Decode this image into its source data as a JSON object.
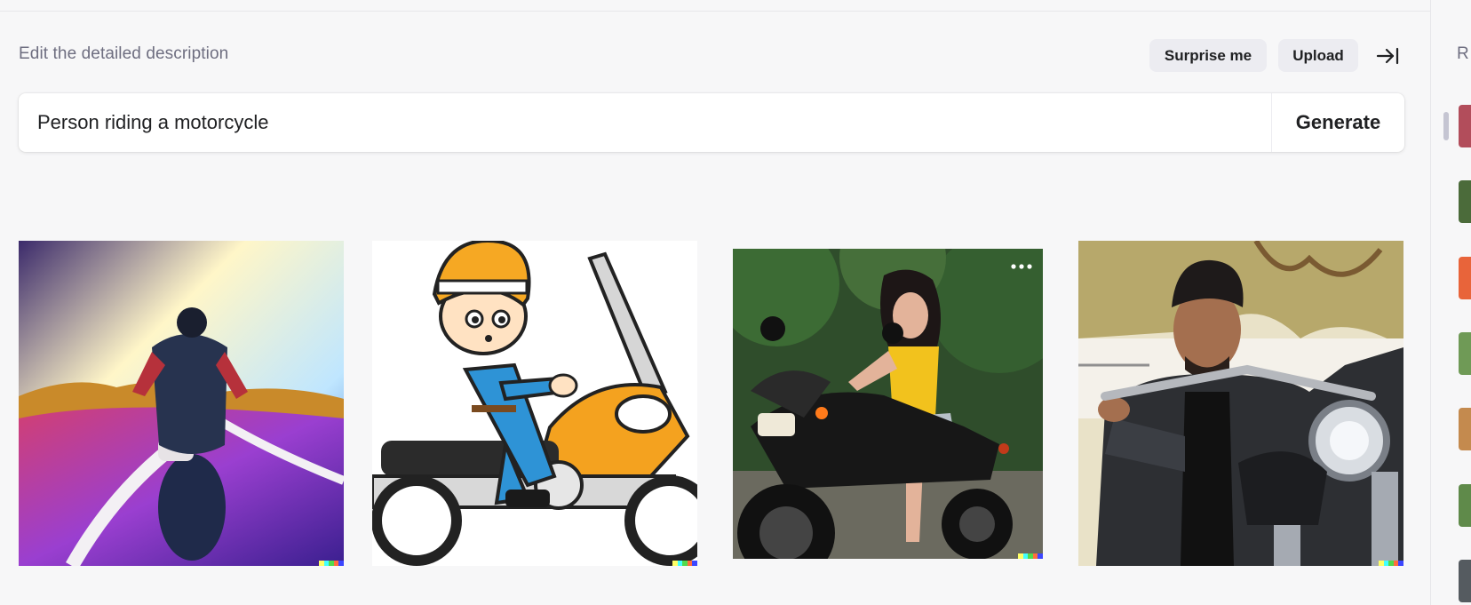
{
  "header": {
    "prompt_label": "Edit the detailed description",
    "surprise_label": "Surprise me",
    "upload_label": "Upload",
    "collapse_icon": "arrow-to-right-icon"
  },
  "prompt": {
    "value": "Person riding a motorcycle",
    "generate_label": "Generate"
  },
  "results": [
    {
      "alt": "Motorcycle rider on a purple glittering road toward hills",
      "style": "surreal-road"
    },
    {
      "alt": "Cartoon person in orange helmet riding a motorcycle",
      "style": "cartoon"
    },
    {
      "alt": "Woman in yellow top sitting on a black motorcycle",
      "style": "photo-woman",
      "options_icon": "more-horizontal-icon"
    },
    {
      "alt": "Man in leather jacket sitting on a chrome motorcycle",
      "style": "photo-man"
    }
  ],
  "history": {
    "label": "R",
    "thumbnails": [
      {
        "color": "#b24d5b"
      },
      {
        "color": "#4b6b3a"
      },
      {
        "color": "#e8643a"
      },
      {
        "color": "#6f9a56"
      },
      {
        "color": "#c48a4e"
      },
      {
        "color": "#5f8a4a"
      },
      {
        "color": "#555b60"
      }
    ]
  },
  "colors": {
    "background": "#f7f7f8",
    "pill": "#ececf1",
    "text": "#202123",
    "muted": "#6e6e80",
    "signature": [
      "#ffff66",
      "#42ffff",
      "#51da4c",
      "#ff6e3c",
      "#3c46ff"
    ]
  }
}
